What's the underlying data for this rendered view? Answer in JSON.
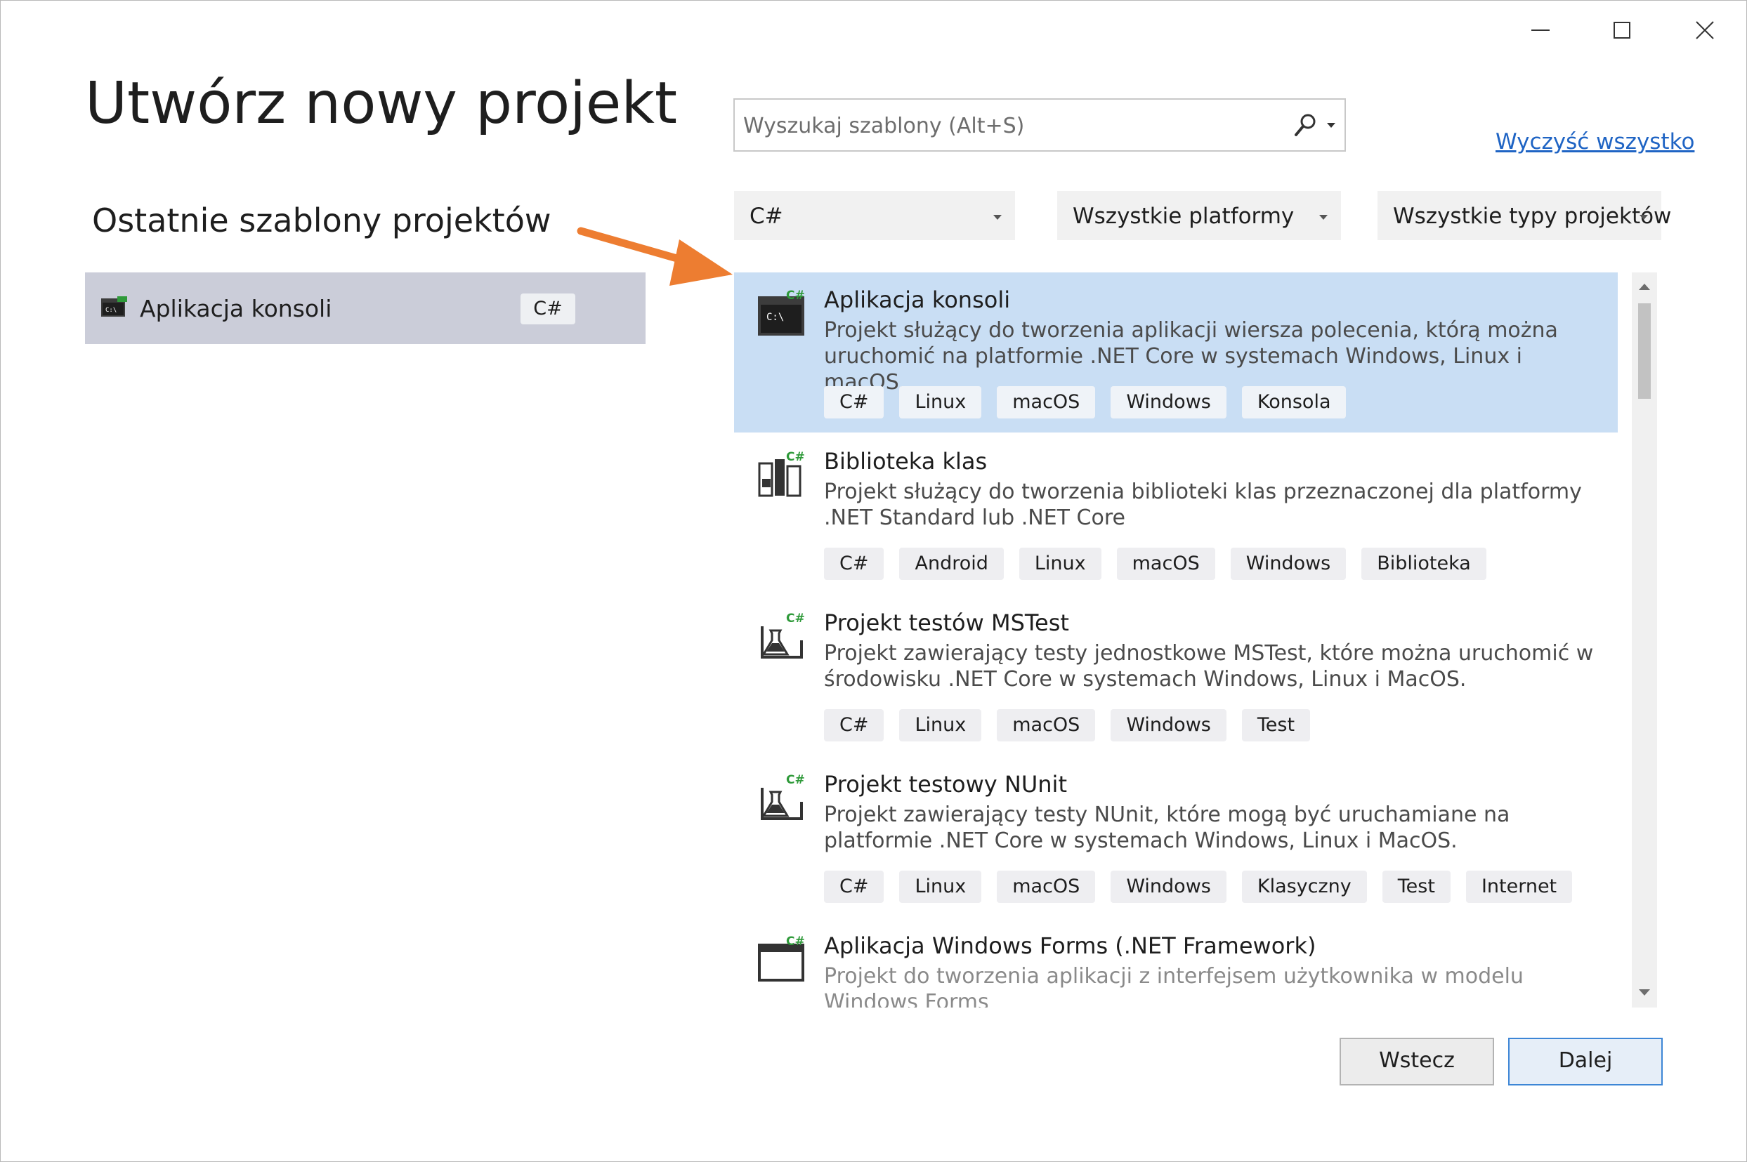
{
  "window": {
    "controls": [
      "minimize-icon",
      "maximize-icon",
      "close-icon"
    ]
  },
  "page_title": "Utwórz nowy projekt",
  "recent": {
    "title": "Ostatnie szablony projektów",
    "items": [
      {
        "label": "Aplikacja konsoli",
        "badge": "C#",
        "icon": "console-app-icon"
      }
    ]
  },
  "search": {
    "placeholder": "Wyszukaj szablony (Alt+S)",
    "icon": "search-icon"
  },
  "clear_all": "Wyczyść wszystko",
  "filters": {
    "language": "C#",
    "platform": "Wszystkie platformy",
    "project_type": "Wszystkie typy projektów"
  },
  "templates": [
    {
      "name": "Aplikacja konsoli",
      "description": "Projekt służący do tworzenia aplikacji wiersza polecenia, którą można uruchomić na platformie .NET Core w systemach Windows, Linux i macOS.",
      "tags": [
        "C#",
        "Linux",
        "macOS",
        "Windows",
        "Konsola"
      ],
      "icon": "console-app-icon",
      "selected": true
    },
    {
      "name": "Biblioteka klas",
      "description": "Projekt służący do tworzenia biblioteki klas przeznaczonej dla platformy .NET Standard lub .NET Core",
      "tags": [
        "C#",
        "Android",
        "Linux",
        "macOS",
        "Windows",
        "Biblioteka"
      ],
      "icon": "class-library-icon"
    },
    {
      "name": "Projekt testów MSTest",
      "description": "Projekt zawierający testy jednostkowe MSTest, które można uruchomić w środowisku .NET Core w systemach Windows, Linux i MacOS.",
      "tags": [
        "C#",
        "Linux",
        "macOS",
        "Windows",
        "Test"
      ],
      "icon": "test-project-icon"
    },
    {
      "name": "Projekt testowy NUnit",
      "description": "Projekt zawierający testy NUnit, które mogą być uruchamiane na platformie .NET Core w systemach Windows, Linux i MacOS.",
      "tags": [
        "C#",
        "Linux",
        "macOS",
        "Windows",
        "Klasyczny",
        "Test",
        "Internet"
      ],
      "icon": "test-project-icon"
    },
    {
      "name": "Aplikacja Windows Forms (.NET Framework)",
      "description": "Projekt do tworzenia aplikacji z interfejsem użytkownika w modelu Windows Forms",
      "tags": [],
      "icon": "windows-forms-icon"
    }
  ],
  "buttons": {
    "back": "Wstecz",
    "next": "Dalej"
  },
  "colors": {
    "selected_bg": "#c9def4",
    "recent_bg": "#cbcdd9",
    "link": "#1f64c4",
    "arrow": "#ed7d31",
    "csharp_green": "#2f9a3a"
  }
}
